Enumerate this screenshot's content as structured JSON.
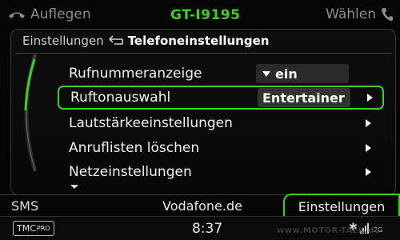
{
  "top": {
    "hangup_label": "Auflegen",
    "device_name": "GT-I9195",
    "dial_label": "Wählen"
  },
  "breadcrumb": {
    "parent": "Einstellungen",
    "current": "Telefoneinstellungen"
  },
  "menu": {
    "items": [
      {
        "label": "Rufnummeranzeige",
        "value": "ein"
      },
      {
        "label": "Ruftonauswahl",
        "value": "Entertainer"
      },
      {
        "label": "Lautstärkeeinstellungen"
      },
      {
        "label": "Anruflisten löschen"
      },
      {
        "label": "Netzeinstellungen"
      }
    ]
  },
  "bottom": {
    "sms_label": "SMS",
    "provider": "Vodafone.de",
    "settings_tab": "Einstellungen"
  },
  "footer": {
    "tmc": "TMC",
    "tmc_pro": "PRO",
    "time": "8:37",
    "network": "2G",
    "watermark": "www.MOTOR-TALK.de"
  },
  "colors": {
    "accent": "#3dd21a",
    "text": "#f2f2f2",
    "muted": "#8d8d8d"
  }
}
